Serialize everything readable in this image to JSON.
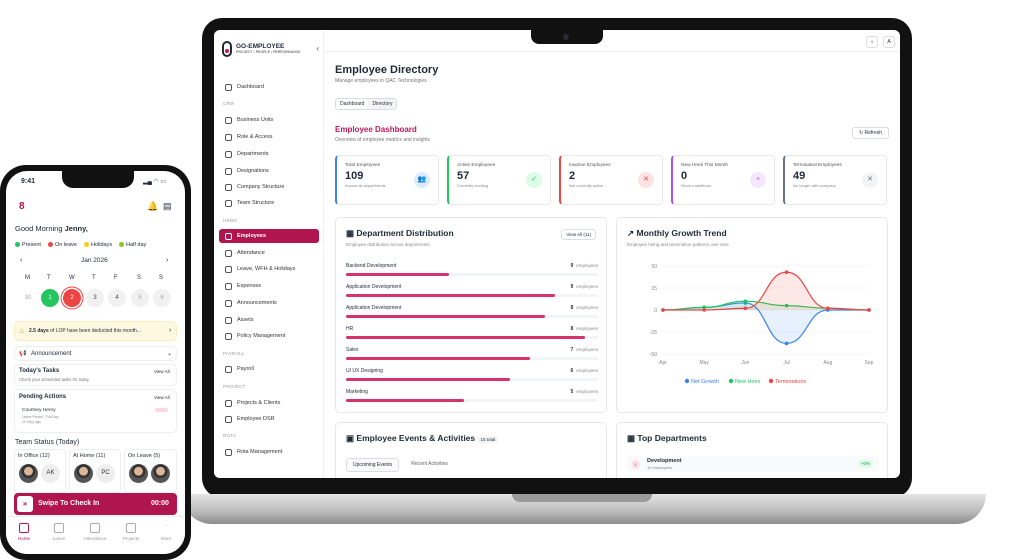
{
  "app": {
    "name": "GO-EMPLOYEE",
    "tagline": "PROJECT • PEOPLE • PERFORMANCE",
    "avatar": "A"
  },
  "sidebar": {
    "dashboard": "Dashboard",
    "crm_label": "CRM",
    "crm": [
      "Business Units",
      "Role & Access",
      "Departments",
      "Designations",
      "Company Structure",
      "Team Structure"
    ],
    "hrms_label": "HRMS",
    "hrms": [
      "Employees",
      "Attendance",
      "Leave, WFH & Holidays",
      "Expenses",
      "Announcements",
      "Assets",
      "Policy Management"
    ],
    "payroll_label": "PAYROLL",
    "payroll": [
      "Payroll"
    ],
    "project_label": "PROJECT",
    "project": [
      "Projects & Clients",
      "Employee DSR"
    ],
    "rota_label": "ROTA",
    "rota": [
      "Rota Management"
    ]
  },
  "page": {
    "title": "Employee Directory",
    "subtitle": "Manage employees in QAC Technologies",
    "tabs": [
      "Dashboard",
      "Directory"
    ],
    "dash_title": "Employee Dashboard",
    "dash_subtitle": "Overview of employee metrics and insights",
    "refresh": "Refresh"
  },
  "stats": [
    {
      "label": "Total Employees",
      "value": "109",
      "hint": "Across all departments",
      "color": "#3b82f6"
    },
    {
      "label": "Active Employees",
      "value": "57",
      "hint": "Currently working",
      "color": "#22c55e"
    },
    {
      "label": "Inactive Employees",
      "value": "2",
      "hint": "Not currently active",
      "color": "#ef4444"
    },
    {
      "label": "New Hires This Month",
      "value": "0",
      "hint": "Recent additions",
      "color": "#a855f7"
    },
    {
      "label": "Terminated Employees",
      "value": "49",
      "hint": "No longer with company",
      "color": "#6b7280"
    }
  ],
  "dept_dist": {
    "title": "Department Distribution",
    "subtitle": "Employee distribution across departments",
    "view_all": "View All (11)",
    "unit": "employees",
    "rows": [
      {
        "name": "Backend Development",
        "count": 9,
        "fill": 0.41
      },
      {
        "name": "Application Development",
        "count": 9,
        "fill": 0.83
      },
      {
        "name": "Application Development",
        "count": 8,
        "fill": 0.79
      },
      {
        "name": "HR",
        "count": 8,
        "fill": 0.95
      },
      {
        "name": "Sales",
        "count": 7,
        "fill": 0.73
      },
      {
        "name": "UI UX Designing",
        "count": 6,
        "fill": 0.65
      },
      {
        "name": "Marketing",
        "count": 5,
        "fill": 0.47
      }
    ]
  },
  "chart_data": {
    "type": "line",
    "title": "Monthly Growth Trend",
    "subtitle": "Employee hiring and termination patterns over time",
    "categories": [
      "Apr",
      "May",
      "Jun",
      "Jul",
      "Aug",
      "Sep"
    ],
    "ylim": [
      -50,
      50
    ],
    "yticks": [
      50,
      25,
      0,
      -25,
      -50
    ],
    "series": [
      {
        "name": "Net Growth",
        "color": "#3b82f6",
        "values": [
          0,
          3,
          8,
          -38,
          0,
          0
        ]
      },
      {
        "name": "New Hires",
        "color": "#22c55e",
        "values": [
          0,
          3,
          10,
          5,
          2,
          0
        ]
      },
      {
        "name": "Terminations",
        "color": "#ef4444",
        "values": [
          0,
          0,
          2,
          43,
          2,
          0
        ]
      }
    ]
  },
  "events": {
    "title": "Employee Events & Activities",
    "badge": "15 total",
    "tabs": [
      "Upcoming Events",
      "Recent Activities"
    ]
  },
  "top_depts": {
    "title": "Top Departments",
    "first": "Development",
    "first_sub": "10 employees",
    "badge": "+0%"
  },
  "phone": {
    "time": "9:41",
    "greeting": "Good Morning",
    "user": "Jenny,",
    "legend": [
      {
        "label": "Present",
        "color": "#22c55e"
      },
      {
        "label": "On leave",
        "color": "#ef4444"
      },
      {
        "label": "Holidays",
        "color": "#facc15"
      },
      {
        "label": "Half day",
        "color": "#84cc16"
      }
    ],
    "month": "Jan 2026",
    "weekdays": [
      "M",
      "T",
      "W",
      "T",
      "F",
      "S",
      "S"
    ],
    "days": [
      "30",
      "1",
      "2",
      "3",
      "4",
      "5",
      "6"
    ],
    "lop_bold": "2.5 days",
    "lop": "of LOP have been deducted this month...",
    "announcement": "Announcement",
    "tasks_title": "Today's Tasks",
    "tasks_sub": "Check your scheduled tasks for today.",
    "view_all": "View All",
    "pending_title": "Pending Actions",
    "pending_name": "Courtney Henry",
    "pending_line1": "Leave Period - Full Day",
    "pending_line2": "10 hr(s) ago",
    "team_title": "Team Status (Today)",
    "in_office": "In Office (12)",
    "at_home": "At Home (11)",
    "on_leave": "On Leave (5)",
    "initials_ak": "AK",
    "initials_pc": "PC",
    "swipe": "Swipe To Check In",
    "swipe_time": "00:00",
    "nav": [
      "Home",
      "Leave",
      "Attendance",
      "Projects",
      "More"
    ]
  }
}
